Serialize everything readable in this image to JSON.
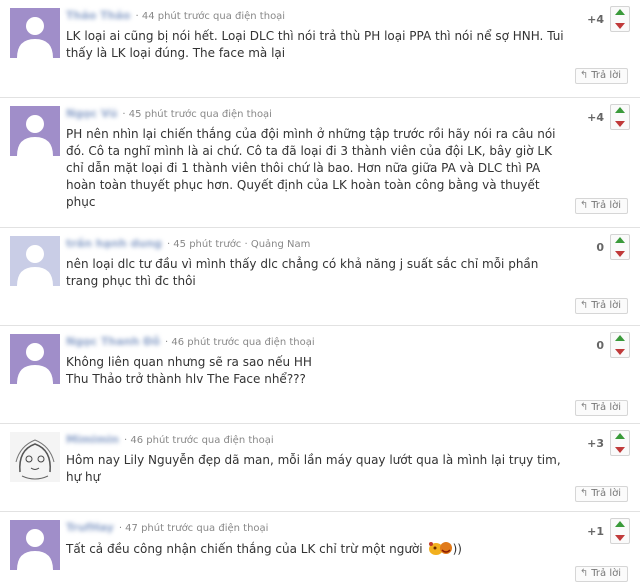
{
  "colors": {
    "avatar": "#a08ec9",
    "up": "#3a9a3a",
    "down": "#c03a3a"
  },
  "reply_label": "Trả lời",
  "comments": [
    {
      "name": "Thảo Thảo",
      "time": "44 phút trước qua điện thoại",
      "votes": "+4",
      "text": "LK loại ai cũng bị nói hết. Loại DLC thì nói trả thù PH loại PPA thì nói nể sợ HNH. Tui thấy là LK loại đúng. The face mà lại"
    },
    {
      "name": "Ngọc Vũ",
      "time": "45 phút trước qua điện thoại",
      "votes": "+4",
      "text": "PH nên nhìn lại chiến thắng của đội mình ở những tập trước rồi hãy nói ra câu nói đó. Cô ta nghĩ mình là ai chứ. Cô ta đã loại đi 3 thành viên của đội LK, bây giờ LK chỉ dẫn mặt loại đi 1 thành viên thôi chứ là bao. Hơn nữa giữa PA và DLC thì PA hoàn toàn thuyết phục hơn. Quyết định của LK hoàn toàn công bằng và thuyết phục"
    },
    {
      "name": "trần hạnh dung",
      "time": "45 phút trước · Quảng Nam",
      "votes": "0",
      "text": "nên loại dlc tư đầu vì mình thấy dlc chẳng có khả năng j suất sắc chỉ mỗi phần trang phục thì đc thôi"
    },
    {
      "name": "Ngọc Thanh Đỗ",
      "time": "46 phút trước qua điện thoại",
      "votes": "0",
      "text": "Không liên quan nhưng sẽ ra sao nếu HH\nThu Thảo trở thành hlv The Face nhể???"
    },
    {
      "name": "Mimimin",
      "time": "46 phút trước qua điện thoại",
      "votes": "+3",
      "text": "Hôm nay Lily Nguyễn đẹp dã man, mỗi lần máy quay lướt qua là mình lại trụy tim, hự hự"
    },
    {
      "name": "TrufHay",
      "time": "47 phút trước qua điện thoại",
      "votes": "+1",
      "text": "Tất cả đều công nhận chiến thắng của LK chỉ trừ một người",
      "text_tail": "))"
    }
  ]
}
